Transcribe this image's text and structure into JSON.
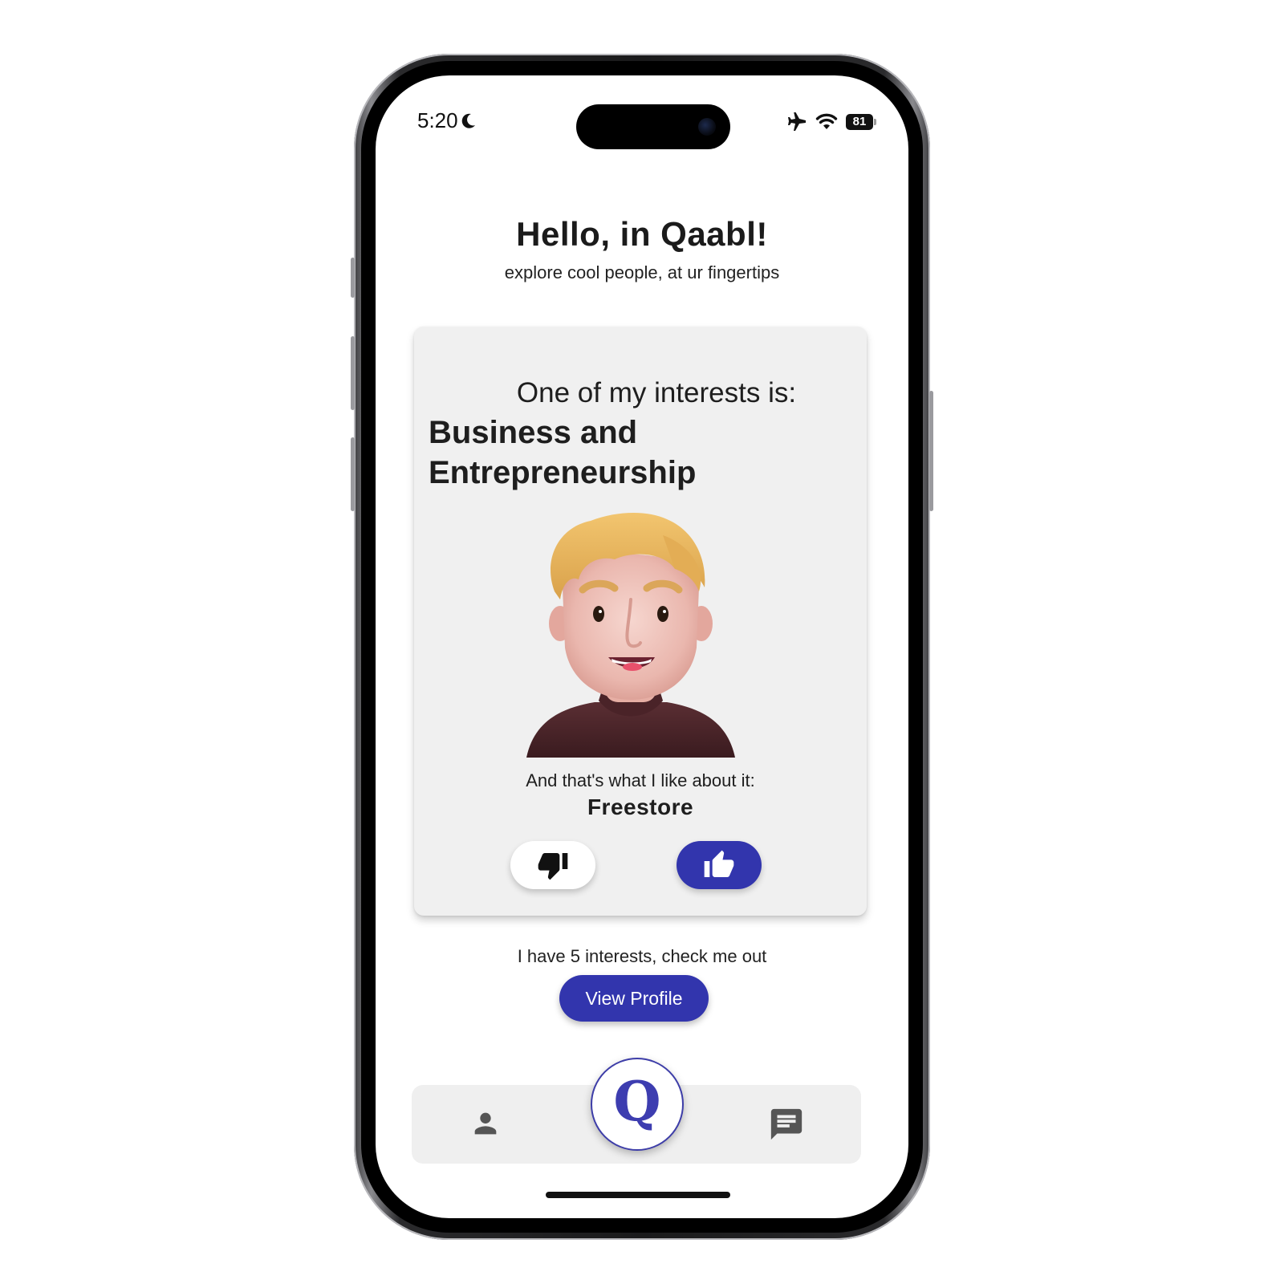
{
  "status_bar": {
    "time": "5:20",
    "battery": "81",
    "icons": [
      "moon-icon",
      "airplane-icon",
      "wifi-icon",
      "battery-icon"
    ]
  },
  "header": {
    "title": "Hello, in Qaabl!",
    "subtitle": "explore cool people, at ur fingertips"
  },
  "card": {
    "heading": "One of my interests is:",
    "interest": "Business and Entrepreneurship",
    "like_label": "And that's what I like about it:",
    "like_value": "Freestore",
    "buttons": {
      "dislike_icon": "thumbs-down-icon",
      "like_icon": "thumbs-up-icon"
    }
  },
  "profile_prompt": {
    "text": "I have 5 interests, check me out",
    "button_label": "View Profile"
  },
  "bottom_nav": {
    "left_icon": "person-icon",
    "center_logo": "Q",
    "right_icon": "chat-icon"
  },
  "colors": {
    "accent": "#3235ad",
    "card_bg": "#f0f0f0",
    "nav_bg": "#efefef"
  }
}
